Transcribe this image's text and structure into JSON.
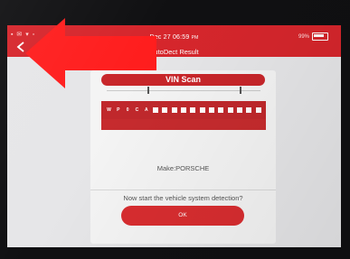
{
  "device": {
    "status_icons": "▪ ✉ ▾ ▫",
    "datetime": "Dec 27 06:59",
    "datetime_suffix": "PM",
    "battery_text": "99%"
  },
  "header": {
    "title": "AutoDect Result",
    "back_icon": "chevron-left-icon"
  },
  "vin_panel": {
    "header_label": "VIN Scan",
    "vin_characters": [
      "W",
      "P",
      "0",
      "C",
      "A",
      "▪",
      "▪",
      "▪",
      "▪",
      "▪",
      "▪",
      "▪",
      "▪",
      "▪",
      "▪",
      "▪",
      "▪"
    ],
    "make_text": "Make:PORSCHE",
    "prompt_text": "Now start the vehicle system detection?",
    "ok_label": "OK"
  },
  "overlay": {
    "arrow_color": "#ff1e1e",
    "arrow_direction": "left"
  },
  "colors": {
    "accent_red": "#d6262c",
    "screen_bg": "#e6e6e8"
  }
}
